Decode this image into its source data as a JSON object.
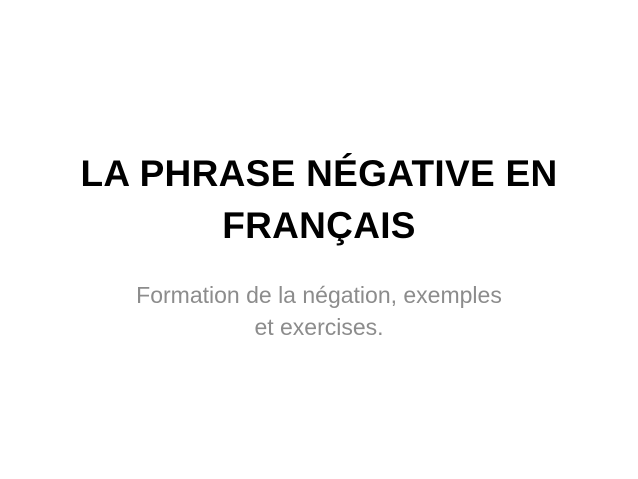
{
  "slide": {
    "title_lines": [
      "LA PHRASE NÉGATIVE EN",
      "FRANÇAIS"
    ],
    "subtitle_lines": [
      "Formation de la négation, exemples",
      "et exercises."
    ],
    "colors": {
      "background": "#ffffff",
      "title": "#000000",
      "subtitle": "#8c8c8c"
    }
  }
}
